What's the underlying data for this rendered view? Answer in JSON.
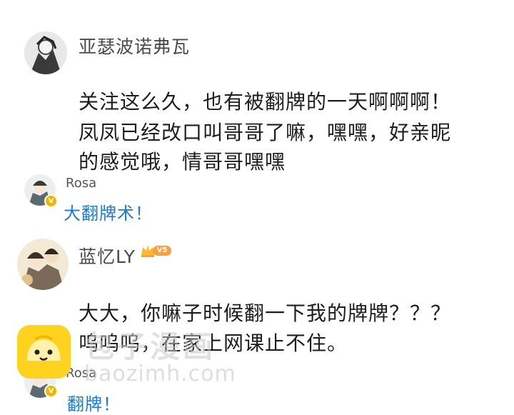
{
  "comments": [
    {
      "username": "亚瑟波诺弗瓦",
      "lines": [
        "关注这么久，也有被翻牌的一天啊啊啊！",
        "凤凤已经改口叫哥哥了嘛，嘿嘿，好亲昵",
        "的感觉哦，情哥哥嘿嘿"
      ],
      "reply": {
        "username": "Rosa",
        "text": "大翻牌术！",
        "badge": "V"
      }
    },
    {
      "username": "蓝忆LY",
      "vip_level": "V5",
      "lines": [
        "大大，你嘛子时候翻一下我的牌牌？？？",
        "呜呜呜，在家上网课止不住。"
      ],
      "reply": {
        "username": "Rosa",
        "text": "翻牌！",
        "badge": "V"
      }
    }
  ],
  "watermark": {
    "name": "包子漫画",
    "url": "baozimh.com"
  },
  "colors": {
    "reply_link": "#1a7ad9",
    "vip_orange": "#ff9d3a",
    "badge_gold": "#f2b400"
  }
}
